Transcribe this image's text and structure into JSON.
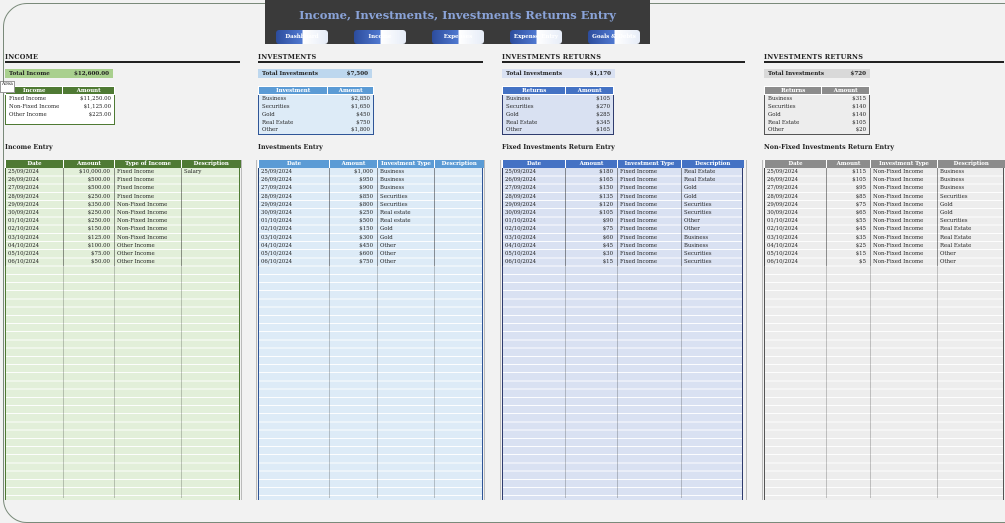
{
  "title": "Income, Investments, Investments Returns Entry",
  "nav": [
    "Dashboard",
    "Income",
    "Expenses",
    "Expense Entry",
    "Goals & Debts"
  ],
  "tooltip": "Area",
  "income": {
    "heading": "INCOME",
    "total_label": "Total  Income",
    "total_value": "$12,600.00",
    "summary_headers": [
      "Income",
      "Amount"
    ],
    "summary_rows": [
      [
        "Fixed Income",
        "$11,250.00"
      ],
      [
        "Non-Fixed Income",
        "$1,125.00"
      ],
      [
        "Other Income",
        "$225.00"
      ]
    ],
    "entry_heading": "Income Entry",
    "entry_headers": [
      "Date",
      "Amount",
      "Type of Income",
      "Description"
    ],
    "entry_rows": [
      [
        "25/09/2024",
        "$10,000.00",
        "Fixed Income",
        "Salary"
      ],
      [
        "26/09/2024",
        "$500.00",
        "Fixed Income",
        ""
      ],
      [
        "27/09/2024",
        "$500.00",
        "Fixed Income",
        ""
      ],
      [
        "28/09/2024",
        "$250.00",
        "Fixed Income",
        ""
      ],
      [
        "29/09/2024",
        "$350.00",
        "Non-Fixed Income",
        ""
      ],
      [
        "30/09/2024",
        "$250.00",
        "Non-Fixed Income",
        ""
      ],
      [
        "01/10/2024",
        "$250.00",
        "Non-Fixed Income",
        ""
      ],
      [
        "02/10/2024",
        "$150.00",
        "Non-Fixed Income",
        ""
      ],
      [
        "03/10/2024",
        "$125.00",
        "Non-Fixed Income",
        ""
      ],
      [
        "04/10/2024",
        "$100.00",
        "Other Income",
        ""
      ],
      [
        "05/10/2024",
        "$75.00",
        "Other Income",
        ""
      ],
      [
        "06/10/2024",
        "$50.00",
        "Other Income",
        ""
      ]
    ]
  },
  "investments": {
    "heading": "INVESTMENTS",
    "total_label": "Total  Investments",
    "total_value": "$7,500",
    "summary_headers": [
      "Investment",
      "Amount"
    ],
    "summary_rows": [
      [
        "Business",
        "$2,850"
      ],
      [
        "Securities",
        "$1,650"
      ],
      [
        "Gold",
        "$450"
      ],
      [
        "Real Estate",
        "$750"
      ],
      [
        "Other",
        "$1,800"
      ]
    ],
    "entry_heading": "Investments Entry",
    "entry_headers": [
      "Date",
      "Amount",
      "Investment Type",
      "Description"
    ],
    "entry_rows": [
      [
        "25/09/2024",
        "$1,000",
        "Business",
        ""
      ],
      [
        "26/09/2024",
        "$950",
        "Business",
        ""
      ],
      [
        "27/09/2024",
        "$900",
        "Business",
        ""
      ],
      [
        "28/09/2024",
        "$850",
        "Securities",
        ""
      ],
      [
        "29/09/2024",
        "$800",
        "Securities",
        ""
      ],
      [
        "30/09/2024",
        "$250",
        "Real estate",
        ""
      ],
      [
        "01/10/2024",
        "$500",
        "Real estate",
        ""
      ],
      [
        "02/10/2024",
        "$150",
        "Gold",
        ""
      ],
      [
        "03/10/2024",
        "$300",
        "Gold",
        ""
      ],
      [
        "04/10/2024",
        "$450",
        "Other",
        ""
      ],
      [
        "05/10/2024",
        "$600",
        "Other",
        ""
      ],
      [
        "06/10/2024",
        "$750",
        "Other",
        ""
      ]
    ]
  },
  "fixed_returns": {
    "heading": "INVESTMENTS  RETURNS",
    "total_label": "Total  Investments",
    "total_value": "$1,170",
    "summary_headers": [
      "Returns",
      "Amount"
    ],
    "summary_rows": [
      [
        "Business",
        "$105"
      ],
      [
        "Securities",
        "$270"
      ],
      [
        "Gold",
        "$285"
      ],
      [
        "Real Estate",
        "$345"
      ],
      [
        "Other",
        "$165"
      ]
    ],
    "entry_heading": "Fixed Investments Return Entry",
    "entry_headers": [
      "Date",
      "Amount",
      "Investment Type",
      "Description"
    ],
    "entry_rows": [
      [
        "25/09/2024",
        "$180",
        "Fixed Income",
        "Real Estate"
      ],
      [
        "26/09/2024",
        "$165",
        "Fixed Income",
        "Real Estate"
      ],
      [
        "27/09/2024",
        "$150",
        "Fixed Income",
        "Gold"
      ],
      [
        "28/09/2024",
        "$135",
        "Fixed Income",
        "Gold"
      ],
      [
        "29/09/2024",
        "$120",
        "Fixed Income",
        "Securities"
      ],
      [
        "30/09/2024",
        "$105",
        "Fixed Income",
        "Securities"
      ],
      [
        "01/10/2024",
        "$90",
        "Fixed Income",
        "Other"
      ],
      [
        "02/10/2024",
        "$75",
        "Fixed Income",
        "Other"
      ],
      [
        "03/10/2024",
        "$60",
        "Fixed Income",
        "Business"
      ],
      [
        "04/10/2024",
        "$45",
        "Fixed Income",
        "Business"
      ],
      [
        "05/10/2024",
        "$30",
        "Fixed Income",
        "Securities"
      ],
      [
        "06/10/2024",
        "$15",
        "Fixed Income",
        "Securities"
      ]
    ]
  },
  "nonfixed_returns": {
    "heading": "INVESTMENTS  RETURNS",
    "total_label": "Total  Investments",
    "total_value": "$720",
    "summary_headers": [
      "Returns",
      "Amount"
    ],
    "summary_rows": [
      [
        "Business",
        "$315"
      ],
      [
        "Securities",
        "$140"
      ],
      [
        "Gold",
        "$140"
      ],
      [
        "Real Estate",
        "$105"
      ],
      [
        "Other",
        "$20"
      ]
    ],
    "entry_heading": "Non-Fixed Investments Return Entry",
    "entry_headers": [
      "Date",
      "Amount",
      "Investment Type",
      "Description"
    ],
    "entry_rows": [
      [
        "25/09/2024",
        "$115",
        "Non-Fixed Income",
        "Business"
      ],
      [
        "26/09/2024",
        "$105",
        "Non-Fixed Income",
        "Business"
      ],
      [
        "27/09/2024",
        "$95",
        "Non-Fixed Income",
        "Business"
      ],
      [
        "28/09/2024",
        "$85",
        "Non-Fixed Income",
        "Securities"
      ],
      [
        "29/09/2024",
        "$75",
        "Non-Fixed Income",
        "Gold"
      ],
      [
        "30/09/2024",
        "$65",
        "Non-Fixed Income",
        "Gold"
      ],
      [
        "01/10/2024",
        "$55",
        "Non-Fixed Income",
        "Securities"
      ],
      [
        "02/10/2024",
        "$45",
        "Non-Fixed Income",
        "Real Estate"
      ],
      [
        "03/10/2024",
        "$35",
        "Non-Fixed Income",
        "Real Estate"
      ],
      [
        "04/10/2024",
        "$25",
        "Non-Fixed Income",
        "Real Estate"
      ],
      [
        "05/10/2024",
        "$15",
        "Non-Fixed Income",
        "Other"
      ],
      [
        "06/10/2024",
        "$5",
        "Non-Fixed Income",
        "Other"
      ]
    ]
  },
  "colors": {
    "income_header": "#4f7a34",
    "income_fill": "#e2efd9",
    "income_total": "#a9d08e",
    "inv_header": "#5b9bd5",
    "inv_fill": "#ddebf7",
    "inv_total": "#bdd7ee",
    "fix_header": "#4472c4",
    "fix_fill": "#d9e1f2",
    "fix_total": "#d9e1f2",
    "non_header": "#8c8c8c",
    "non_fill": "#ededed",
    "non_total": "#d9d9d9"
  }
}
